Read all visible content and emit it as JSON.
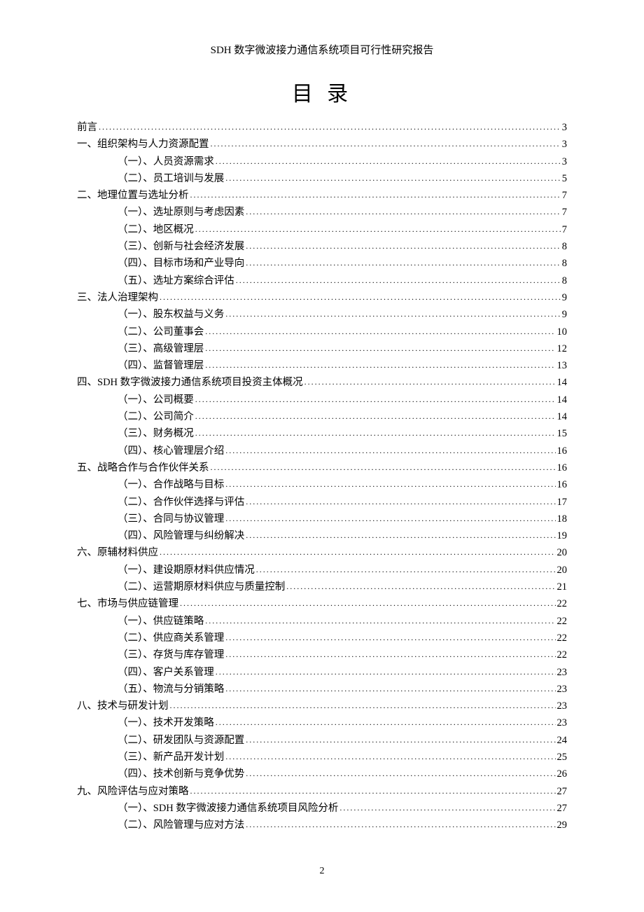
{
  "header": "SDH 数字微波接力通信系统项目可行性研究报告",
  "toc_title": "目 录",
  "page_number": "2",
  "entries": [
    {
      "level": 1,
      "label": "前言",
      "page": "3"
    },
    {
      "level": 1,
      "label": "一、组织架构与人力资源配置",
      "page": "3"
    },
    {
      "level": 2,
      "label": "（一）、人员资源需求",
      "page": "3"
    },
    {
      "level": 2,
      "label": "（二）、员工培训与发展",
      "page": "5"
    },
    {
      "level": 1,
      "label": "二、地理位置与选址分析",
      "page": "7"
    },
    {
      "level": 2,
      "label": "（一）、选址原则与考虑因素",
      "page": "7"
    },
    {
      "level": 2,
      "label": "（二）、地区概况",
      "page": "7"
    },
    {
      "level": 2,
      "label": "（三）、创新与社会经济发展",
      "page": "8"
    },
    {
      "level": 2,
      "label": "（四）、目标市场和产业导向",
      "page": "8"
    },
    {
      "level": 2,
      "label": "（五）、选址方案综合评估",
      "page": "8"
    },
    {
      "level": 1,
      "label": "三、法人治理架构",
      "page": "9"
    },
    {
      "level": 2,
      "label": "（一）、股东权益与义务",
      "page": "9"
    },
    {
      "level": 2,
      "label": "（二）、公司董事会",
      "page": "10"
    },
    {
      "level": 2,
      "label": "（三）、高级管理层",
      "page": "12"
    },
    {
      "level": 2,
      "label": "（四）、监督管理层",
      "page": "13"
    },
    {
      "level": 1,
      "label": "四、SDH 数字微波接力通信系统项目投资主体概况",
      "page": "14"
    },
    {
      "level": 2,
      "label": "（一）、公司概要",
      "page": "14"
    },
    {
      "level": 2,
      "label": "（二）、公司简介",
      "page": "14"
    },
    {
      "level": 2,
      "label": "（三）、财务概况",
      "page": "15"
    },
    {
      "level": 2,
      "label": "（四）、核心管理层介绍",
      "page": "16"
    },
    {
      "level": 1,
      "label": "五、战略合作与合作伙伴关系",
      "page": "16"
    },
    {
      "level": 2,
      "label": "（一）、合作战略与目标",
      "page": "16"
    },
    {
      "level": 2,
      "label": "（二）、合作伙伴选择与评估",
      "page": "17"
    },
    {
      "level": 2,
      "label": "（三）、合同与协议管理",
      "page": "18"
    },
    {
      "level": 2,
      "label": "（四）、风险管理与纠纷解决",
      "page": "19"
    },
    {
      "level": 1,
      "label": "六、原辅材料供应",
      "page": "20"
    },
    {
      "level": 2,
      "label": "（一）、建设期原材料供应情况",
      "page": "20"
    },
    {
      "level": 2,
      "label": "（二）、运营期原材料供应与质量控制",
      "page": "21"
    },
    {
      "level": 1,
      "label": "七、市场与供应链管理",
      "page": "22"
    },
    {
      "level": 2,
      "label": "（一）、供应链策略",
      "page": "22"
    },
    {
      "level": 2,
      "label": "（二）、供应商关系管理",
      "page": "22"
    },
    {
      "level": 2,
      "label": "（三）、存货与库存管理",
      "page": "22"
    },
    {
      "level": 2,
      "label": "（四）、客户关系管理",
      "page": "23"
    },
    {
      "level": 2,
      "label": "（五）、物流与分销策略",
      "page": "23"
    },
    {
      "level": 1,
      "label": "八、技术与研发计划",
      "page": "23"
    },
    {
      "level": 2,
      "label": "（一）、技术开发策略",
      "page": "23"
    },
    {
      "level": 2,
      "label": "（二）、研发团队与资源配置",
      "page": "24"
    },
    {
      "level": 2,
      "label": "（三）、新产品开发计划",
      "page": "25"
    },
    {
      "level": 2,
      "label": "（四）、技术创新与竞争优势",
      "page": "26"
    },
    {
      "level": 1,
      "label": "九、风险评估与应对策略",
      "page": "27"
    },
    {
      "level": 2,
      "label": "（一）、SDH 数字微波接力通信系统项目风险分析",
      "page": "27"
    },
    {
      "level": 2,
      "label": "（二）、风险管理与应对方法",
      "page": "29"
    }
  ]
}
